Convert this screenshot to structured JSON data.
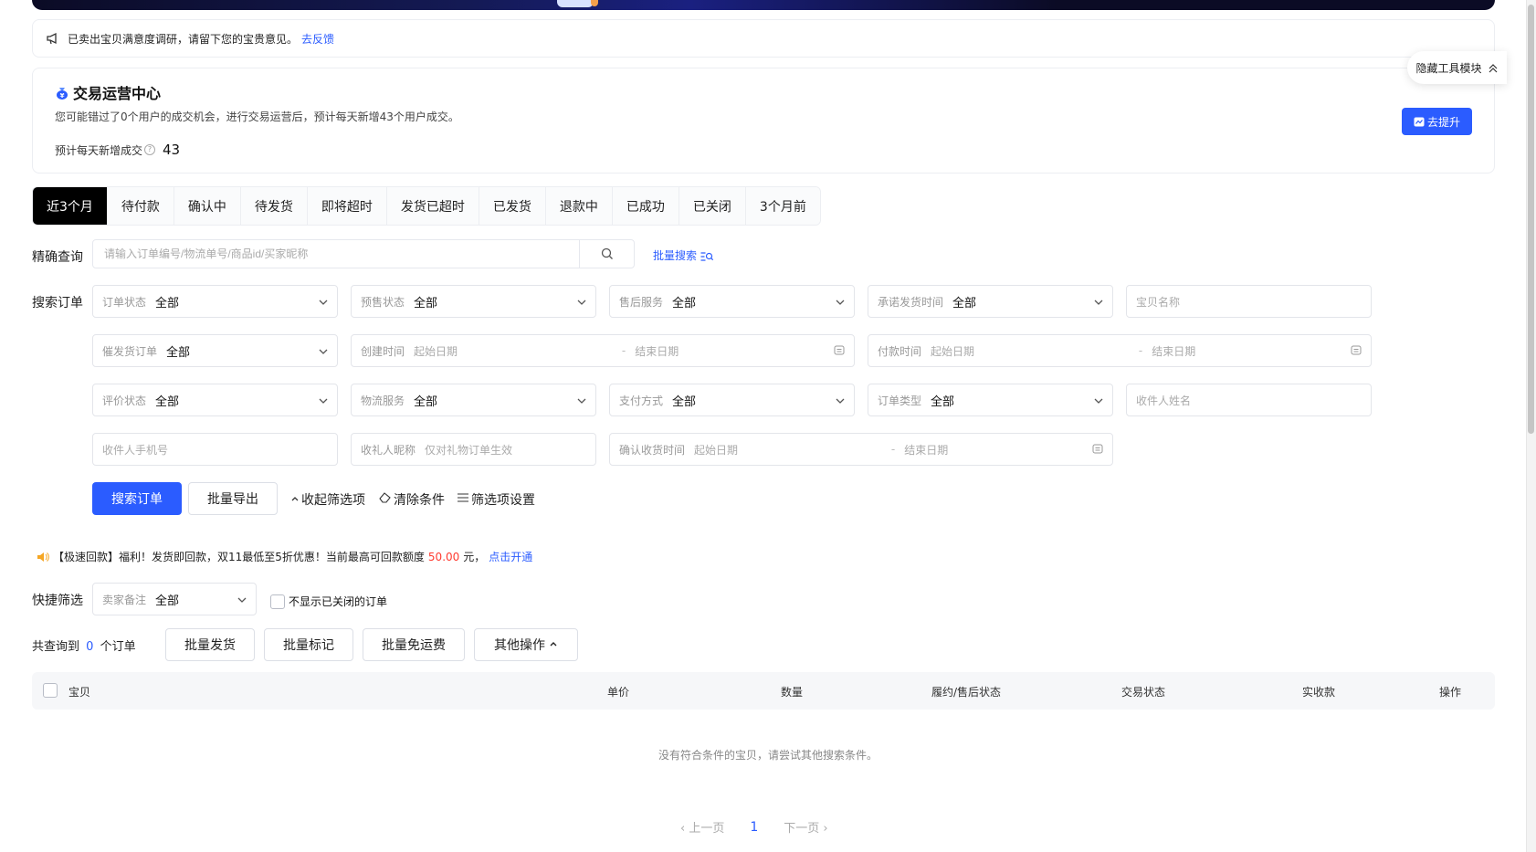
{
  "notice": {
    "text": "已卖出宝贝满意度调研，请留下您的宝贵意见。",
    "link": "去反馈"
  },
  "center": {
    "title": "交易运营中心",
    "desc": "您可能错过了0个用户的成交机会，进行交易运营后，预计每天新增43个用户成交。",
    "stat_label": "预计每天新增成交",
    "stat_value": "43",
    "improve_label": "去提升"
  },
  "hide_tool_label": "隐藏工具模块",
  "tabs": [
    {
      "label": "近3个月"
    },
    {
      "label": "待付款"
    },
    {
      "label": "确认中"
    },
    {
      "label": "待发货"
    },
    {
      "label": "即将超时"
    },
    {
      "label": "发货已超时"
    },
    {
      "label": "已发货"
    },
    {
      "label": "退款中"
    },
    {
      "label": "已成功"
    },
    {
      "label": "已关闭"
    },
    {
      "label": "3个月前"
    }
  ],
  "precise": {
    "label": "精确查询",
    "placeholder": "请输入订单编号/物流单号/商品id/买家昵称",
    "batch_search": "批量搜索"
  },
  "search": {
    "label": "搜索订单",
    "order_status": {
      "label": "订单状态",
      "value": "全部"
    },
    "presale_status": {
      "label": "预售状态",
      "value": "全部"
    },
    "after_sale": {
      "label": "售后服务",
      "value": "全部"
    },
    "promise_time": {
      "label": "承诺发货时间",
      "value": "全部"
    },
    "item_name_ph": "宝贝名称",
    "urge_order": {
      "label": "催发货订单",
      "value": "全部"
    },
    "create_time": {
      "label": "创建时间",
      "start": "起始日期",
      "end": "结束日期"
    },
    "pay_time": {
      "label": "付款时间",
      "start": "起始日期",
      "end": "结束日期"
    },
    "review_status": {
      "label": "评价状态",
      "value": "全部"
    },
    "logistics": {
      "label": "物流服务",
      "value": "全部"
    },
    "pay_method": {
      "label": "支付方式",
      "value": "全部"
    },
    "order_type": {
      "label": "订单类型",
      "value": "全部"
    },
    "receiver_name_ph": "收件人姓名",
    "receiver_phone_ph": "收件人手机号",
    "gift_nick": {
      "label": "收礼人昵称",
      "placeholder": "仅对礼物订单生效"
    },
    "confirm_time": {
      "label": "确认收货时间",
      "start": "起始日期",
      "end": "结束日期"
    }
  },
  "actions": {
    "search": "搜索订单",
    "export": "批量导出",
    "collapse": "收起筛选项",
    "clear": "清除条件",
    "settings": "筛选项设置"
  },
  "promo": {
    "prefix": "【极速回款】福利！发货即回款，双11最低至5折优惠！当前最高可回款额度",
    "amount": "50.00",
    "unit": "元，",
    "link": "点击开通"
  },
  "quick": {
    "label": "快捷筛选",
    "seller_note": {
      "label": "卖家备注",
      "value": "全部"
    },
    "hide_closed": "不显示已关闭的订单"
  },
  "summary": {
    "prefix": "共查询到",
    "count": "0",
    "suffix": "个订单",
    "buttons": [
      "批量发货",
      "批量标记",
      "批量免运费",
      "其他操作"
    ]
  },
  "table": {
    "columns": [
      "宝贝",
      "单价",
      "数量",
      "履约/售后状态",
      "交易状态",
      "实收款",
      "操作"
    ],
    "empty": "没有符合条件的宝贝，请尝试其他搜索条件。"
  },
  "pager": {
    "prev": "上一页",
    "current": "1",
    "next": "下一页"
  }
}
